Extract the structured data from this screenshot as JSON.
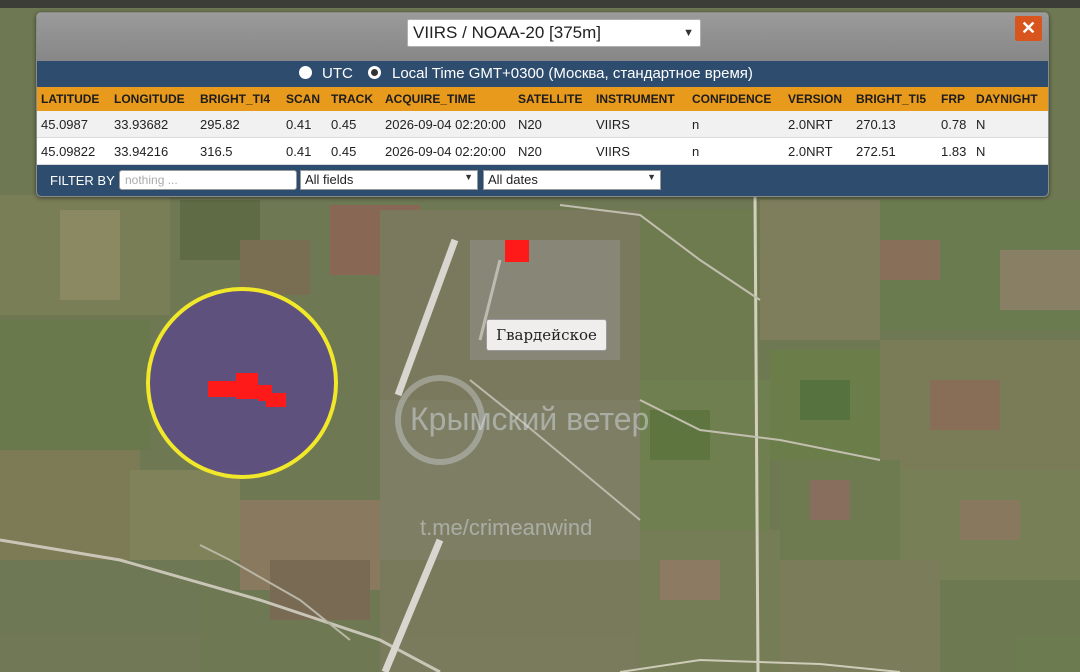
{
  "layer_select": {
    "selected": "VIIRS / NOAA-20 [375m]"
  },
  "close_label": "✕",
  "timezone": {
    "utc_label": "UTC",
    "local_label": "Local Time GMT+0300 (Москва, стандартное время)",
    "selected": "local"
  },
  "table": {
    "columns": [
      "LATITUDE",
      "LONGITUDE",
      "BRIGHT_TI4",
      "SCAN",
      "TRACK",
      "ACQUIRE_TIME",
      "SATELLITE",
      "INSTRUMENT",
      "CONFIDENCE",
      "VERSION",
      "BRIGHT_TI5",
      "FRP",
      "DAYNIGHT"
    ],
    "rows": [
      [
        "45.0987",
        "33.93682",
        "295.82",
        "0.41",
        "0.45",
        "2026-09-04 02:20:00",
        "N20",
        "VIIRS",
        "n",
        "2.0NRT",
        "270.13",
        "0.78",
        "N"
      ],
      [
        "45.09822",
        "33.94216",
        "316.5",
        "0.41",
        "0.45",
        "2026-09-04 02:20:00",
        "N20",
        "VIIRS",
        "n",
        "2.0NRT",
        "272.51",
        "1.83",
        "N"
      ]
    ]
  },
  "filter": {
    "label": "FILTER BY",
    "placeholder": "nothing ...",
    "fields_selected": "All fields",
    "dates_selected": "All dates"
  },
  "map": {
    "place_label": "Гвардейское",
    "watermark_text": "Крымский ветер",
    "watermark_url": "t.me/crimeanwind",
    "fire_color": "#ff1a1a",
    "highlight_color": "#f2e82a"
  },
  "colors": {
    "header_bg": "#2e4d6e",
    "column_header_bg": "#e89a1c",
    "close_bg": "#d9551e"
  },
  "icons": {
    "close": "close-icon",
    "dropdown": "chevron-down-icon"
  }
}
